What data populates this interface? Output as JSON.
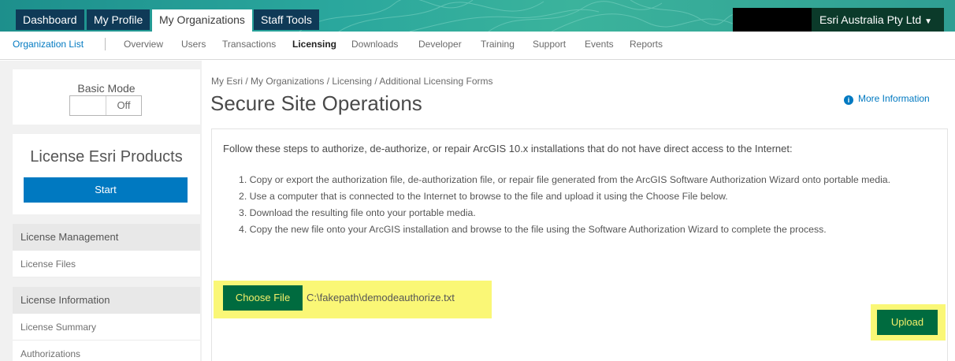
{
  "top_tabs": [
    "Dashboard",
    "My Profile",
    "My Organizations",
    "Staff Tools"
  ],
  "org_menu": {
    "label": "Esri Australia Pty Ltd",
    "caret": "▼"
  },
  "sub_nav": {
    "organization_list": "Organization List",
    "items": [
      "Overview",
      "Users",
      "Transactions",
      "Licensing",
      "Downloads",
      "Developer",
      "Training",
      "Support",
      "Events",
      "Reports"
    ],
    "active": "Licensing"
  },
  "sidebar": {
    "basic_mode": {
      "title": "Basic Mode",
      "state": "Off"
    },
    "license_products": {
      "title": "License Esri Products",
      "button": "Start"
    },
    "sections": [
      {
        "header": "License Management",
        "links": [
          "License Files"
        ]
      },
      {
        "header": "License Information",
        "links": [
          "License Summary",
          "Authorizations"
        ]
      }
    ]
  },
  "main": {
    "breadcrumb": "My Esri / My Organizations / Licensing / Additional Licensing Forms",
    "title": "Secure Site Operations",
    "more_info": "More Information",
    "intro": "Follow these steps to authorize, de-authorize, or repair ArcGIS 10.x installations that do not have direct access to the Internet:",
    "steps": [
      "1. Copy or export the authorization file, de-authorization file, or repair file generated from the ArcGIS Software Authorization Wizard onto portable media.",
      "2. Use a computer that is connected to the Internet to browse to the file and upload it using the Choose File below.",
      "3. Download the resulting file onto your portable media.",
      "4. Copy the new file onto your ArcGIS installation and browse to the file using the Software Authorization Wizard to complete the process."
    ],
    "choose_file_label": "Choose File",
    "file_path": "C:\\fakepath\\demodeauthorize.txt",
    "upload_label": "Upload"
  },
  "colors": {
    "brand_blue": "#0079c1",
    "dark_navy": "#0f3a57",
    "upload_green": "#006b3f",
    "highlight_yellow": "#faf776"
  }
}
